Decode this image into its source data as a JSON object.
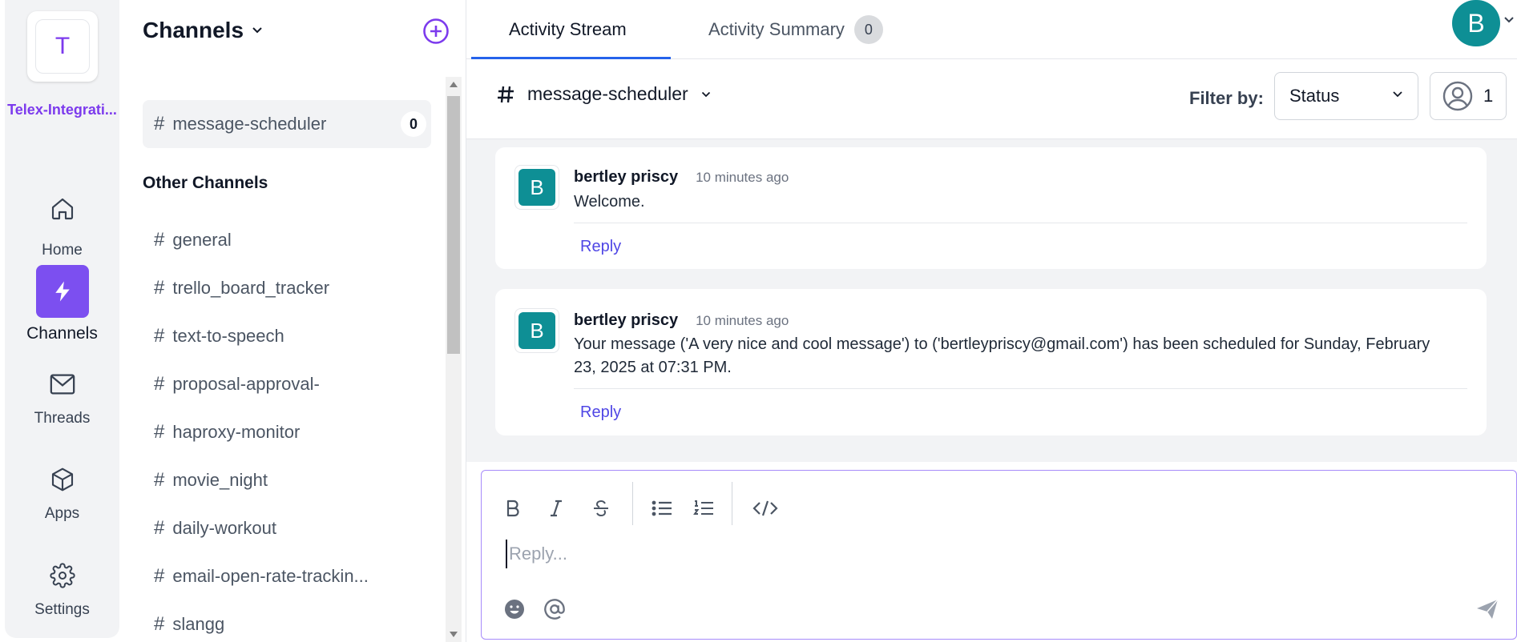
{
  "workspace": {
    "initial": "T",
    "name": "Telex-Integrati..."
  },
  "rail": {
    "items": [
      {
        "label": "Home",
        "icon": "home-icon"
      },
      {
        "label": "Channels",
        "icon": "lightning-icon"
      },
      {
        "label": "Threads",
        "icon": "mail-icon"
      },
      {
        "label": "Apps",
        "icon": "cube-icon"
      },
      {
        "label": "Settings",
        "icon": "gear-icon"
      }
    ]
  },
  "sidebar": {
    "title": "Channels",
    "selected": {
      "name": "message-scheduler",
      "count": "0"
    },
    "other_title": "Other Channels",
    "channels": [
      "general",
      "trello_board_tracker",
      "text-to-speech",
      "proposal-approval-",
      "haproxy-monitor",
      "movie_night",
      "daily-workout",
      "email-open-rate-trackin...",
      "slangg"
    ]
  },
  "tabs": {
    "stream": "Activity Stream",
    "summary": "Activity Summary",
    "summary_count": "0"
  },
  "user": {
    "initial": "B"
  },
  "channel_bar": {
    "name": "message-scheduler",
    "filter_label": "Filter by:",
    "filter_value": "Status",
    "member_count": "1"
  },
  "messages": [
    {
      "initial": "B",
      "author": "bertley priscy",
      "time": "10 minutes ago",
      "body": "Welcome.",
      "reply": "Reply"
    },
    {
      "initial": "B",
      "author": "bertley priscy",
      "time": "10 minutes ago",
      "body": "Your message ('A very nice and cool message') to ('bertleypriscy@gmail.com') has been scheduled for Sunday, February 23, 2025 at 07:31 PM.",
      "reply": "Reply"
    }
  ],
  "composer": {
    "placeholder": "Reply..."
  },
  "colors": {
    "accent": "#7c4ff0",
    "avatar": "#0e8f95",
    "link": "#4f46e5"
  }
}
